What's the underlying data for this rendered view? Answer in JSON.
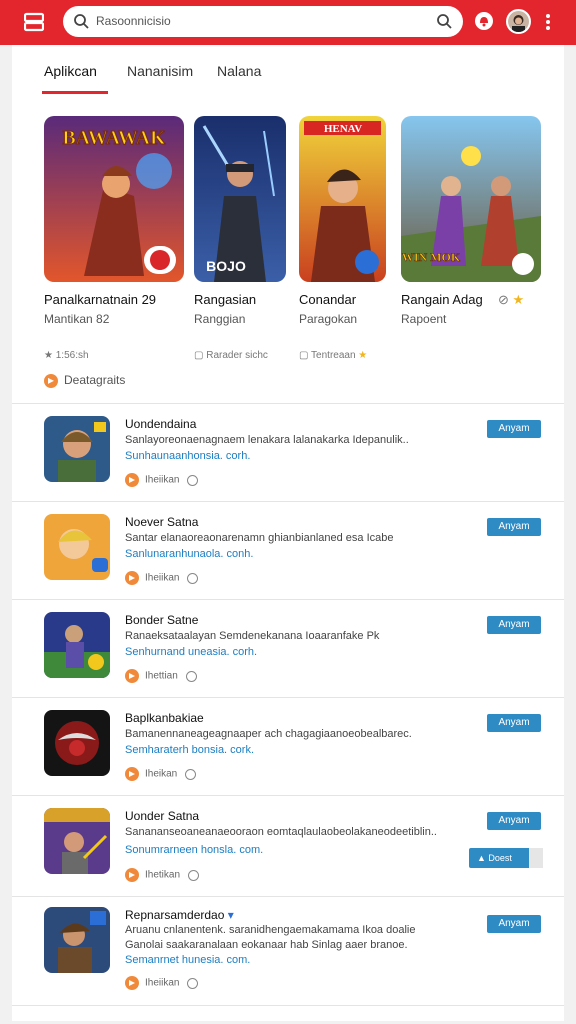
{
  "colors": {
    "brand": "#e3262d",
    "accent": "#2f8bc4",
    "link": "#1c7ec2"
  },
  "header": {
    "search_placeholder": "Rasoonnicisio",
    "icons": [
      "menu-icon",
      "search-icon",
      "bell-icon",
      "avatar",
      "more-icon"
    ]
  },
  "tabs": [
    {
      "label": "Aplikcan",
      "active": true
    },
    {
      "label": "Nananisim",
      "active": false
    },
    {
      "label": "Nalana",
      "active": false
    }
  ],
  "featured": [
    {
      "art_text": "BAWAWAK",
      "title": "Panalkarnatnain 29",
      "subtitle": "Mantikan 82",
      "meta": "★ 1:56:sh"
    },
    {
      "art_text": "BOJO",
      "title": "Rangasian",
      "subtitle": "Ranggian",
      "meta": "Rarader sichc"
    },
    {
      "art_text": "HENAV",
      "title": "Conandar",
      "subtitle": "Paragokan",
      "meta": "Tentreaan"
    },
    {
      "art_text": "WIN MOK",
      "title": "Rangain Adag",
      "subtitle": "Rapoent",
      "meta": ""
    }
  ],
  "featured_footer": "Deatagraits",
  "list": [
    {
      "title": "Uondendaina",
      "desc": "Sanlayoreonaenagnaem lenakara lalanakarka Idepanulik..",
      "link": "Sunhaunaanhonsia. corh.",
      "meta": "Iheiikan",
      "button": "Anyam"
    },
    {
      "title": "Noever Satna",
      "desc": "Santar elanaoreaonarenamn ghianbianlaned esa Icabe",
      "link": "Sanlunaranhunaola. conh.",
      "meta": "Iheiikan",
      "button": "Anyam"
    },
    {
      "title": "Bonder Satne",
      "desc": "Ranaeksataalayan Semdenekanana Ioaaranfake Pk",
      "link": "Senhurnand uneasia. corh.",
      "meta": "Ihettian",
      "button": "Anyam"
    },
    {
      "title": "Baplkanbakiae",
      "desc": "Bamanennaneageagnaaper ach chagagiaanoeobealbarec.",
      "link": "Semharaterh bonsia. cork.",
      "meta": "Iheikan",
      "button": "Anyam"
    },
    {
      "title": "Uonder Satna",
      "desc": "Sanananseoaneanaeooraon eomtaqlaulaobeolakaneodeetiblin..",
      "link": "Sonumrarneen honsla. com.",
      "meta": "Ihetikan",
      "button": "Anyam"
    },
    {
      "title": "Repnarsamderdao",
      "desc": "Aruanu cnlanentenk. saranidhengaemakamama Ikoa doalie",
      "desc2": "Ganolai saakaranalaan eokanaar hab Sinlag aaer branoe.",
      "link": "Semanrnet hunesia. com.",
      "meta": "Iheiikan",
      "button": "Anyam"
    }
  ],
  "like_button": "Doest"
}
